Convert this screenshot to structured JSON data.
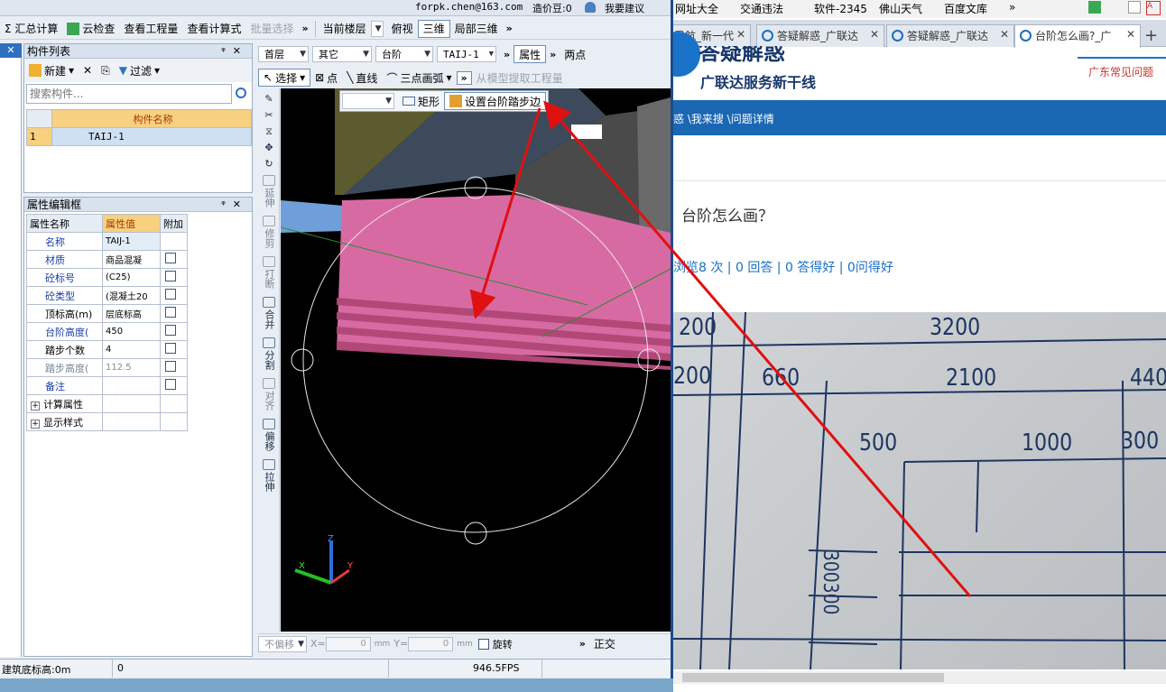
{
  "cad": {
    "top": {
      "account": "forpk.chen@163.com",
      "beans": "造价豆:0",
      "suggest": "我要建议"
    },
    "toolbar": {
      "items": [
        "Σ 汇总计算",
        "云检查",
        "查看工程量",
        "查看计算式",
        "批量选择"
      ],
      "more": "»",
      "floor_label": "当前楼层",
      "view_label": "俯视",
      "view3d_label": "三维",
      "local3d_label": "局部三维"
    },
    "component_list": {
      "title": "构件列表",
      "new_label": "新建",
      "filter_label": "过滤",
      "search_placeholder": "搜索构件...",
      "header": "构件名称",
      "rows": [
        {
          "index": "1",
          "name": "TAIJ-1"
        }
      ]
    },
    "props": {
      "title": "属性编辑框",
      "headers": [
        "属性名称",
        "属性值",
        "附加"
      ],
      "rows": [
        {
          "name": "名称",
          "value": "TAIJ-1",
          "check": false
        },
        {
          "name": "材质",
          "value": "商品混凝",
          "check": true
        },
        {
          "name": "砼标号",
          "value": "(C25)",
          "check": true
        },
        {
          "name": "砼类型",
          "value": "(混凝土20",
          "check": true
        },
        {
          "name": "顶标高(m)",
          "value": "层底标高",
          "check": true
        },
        {
          "name": "台阶高度(",
          "value": "450",
          "check": true
        },
        {
          "name": "踏步个数",
          "value": "4",
          "check": true
        },
        {
          "name": "踏步高度(",
          "value": "112.5",
          "check": true
        },
        {
          "name": "备注",
          "value": "",
          "check": true
        }
      ],
      "groups": [
        "计算属性",
        "显示样式"
      ]
    },
    "viewbar": {
      "floor": "首层",
      "type": "其它",
      "category": "台阶",
      "component": "TAIJ-1",
      "attr_label": "属性",
      "two_point": "两点"
    },
    "drawbar": {
      "select": "选择",
      "point": "点",
      "line": "直线",
      "arc": "三点画弧",
      "extract": "从模型提取工程量"
    },
    "popup": {
      "rect": "矩形",
      "set_edge": "设置台阶踏步边"
    },
    "vtools": [
      "延伸",
      "修剪",
      "打断",
      "合并",
      "分割",
      "对齐",
      "偏移",
      "拉伸"
    ],
    "bottom": {
      "offset": "不偏移",
      "x_label": "X=",
      "x_val": "0",
      "y_label": "Y=",
      "y_val": "0",
      "unit": "mm",
      "rotate": "旋转",
      "ortho": "正交"
    },
    "status": {
      "elev": "建筑底标高:0m",
      "val": "0",
      "fps": "946.5FPS"
    }
  },
  "browser": {
    "bookmarks": [
      "网址大全",
      "交通违法",
      "软件-2345",
      "佛山天气",
      "百度文库"
    ],
    "tabs": [
      {
        "title": "导航_新一代",
        "active": false
      },
      {
        "title": "答疑解惑_广联达",
        "active": false
      },
      {
        "title": "答疑解惑_广联达",
        "active": false
      },
      {
        "title": "台阶怎么画?_广",
        "active": true
      }
    ],
    "site": {
      "title": "答疑解惑",
      "slogan": "广联达服务新干线",
      "faq": "广东常见问题",
      "breadcrumb": "惑 \\我来搜 \\问题详情",
      "question": "台阶怎么画？",
      "stats": "浏览8 次 | 0 回答 | 0 答得好 | 0问得好"
    },
    "photo_dims": [
      "200",
      "3200",
      "200",
      "660",
      "2100",
      "440",
      "500",
      "1000",
      "300",
      "300300"
    ]
  },
  "colors": {
    "accent": "#1a67b3",
    "arrow": "#e01010",
    "step_pink": "#d86aa3"
  }
}
